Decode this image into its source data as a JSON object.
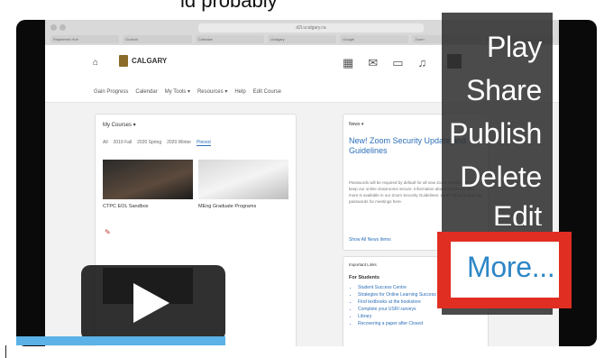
{
  "caption": {
    "text": "ld probably"
  },
  "browser": {
    "address": "d2l.ucalgary.ca",
    "tabs": [
      "Registered Hub",
      "Outlook",
      "Calendar",
      "Ucalgary",
      "Google",
      "Zoom",
      "D2L"
    ]
  },
  "header": {
    "logo_text": "CALGARY",
    "icons": [
      "grid-icon",
      "mail-icon",
      "chat-icon",
      "bell-icon"
    ]
  },
  "nav": {
    "items": [
      "Gain Progress",
      "Calendar",
      "My Tools ▾",
      "Resources ▾",
      "Help",
      "Edit Course"
    ]
  },
  "courses": {
    "title": "My Courses ▾",
    "filters": [
      "All",
      "2019 Fall",
      "2020 Spring",
      "2020 Winter",
      "Pinned"
    ],
    "active_filter": "Pinned",
    "tiles": [
      {
        "label": "CTPC EOL Sandbox"
      },
      {
        "label": "MEng Graduate Programs"
      }
    ]
  },
  "news": {
    "title": "News ▾",
    "headline": "New! Zoom Security Update and Guidelines",
    "body": "Passwords will be required by default for all new Zoom meetings to help keep our online classrooms secure. Information about passwords and more is available in our Zoom Security Guidelines. Learn about how to set passwords for meetings here.",
    "link": "Show All News Items"
  },
  "important_links": {
    "title": "Important Links",
    "subtitle": "For Students",
    "items": [
      "Student Success Centre",
      "Strategies for Online Learning Success",
      "Find textbooks at the bookstore",
      "Complete your USRI surveys",
      "Library",
      "Recovering a paper after Closed"
    ]
  },
  "menu": {
    "play": "Play",
    "share": "Share",
    "publish": "Publish",
    "delete": "Delete",
    "edit": "Edit",
    "more": "More..."
  },
  "player": {
    "progress_fraction": 0.36
  },
  "colors": {
    "highlight_box": "#e12e22",
    "more_text": "#2d86c6",
    "progress": "#5ab2e6"
  }
}
